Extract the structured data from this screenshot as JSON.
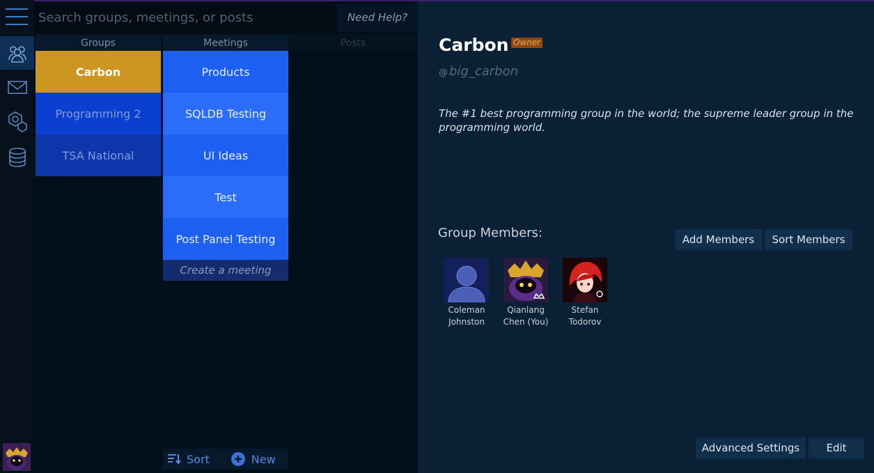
{
  "search": {
    "placeholder": "Search groups, meetings, or posts",
    "help_label": "Need Help?"
  },
  "columns": {
    "groups": "Groups",
    "meetings": "Meetings",
    "posts": "Posts"
  },
  "groups": [
    {
      "label": "Carbon",
      "selected": true
    },
    {
      "label": "Programming 2",
      "selected": false
    },
    {
      "label": "TSA National",
      "selected": false
    }
  ],
  "meetings": [
    {
      "label": "Products"
    },
    {
      "label": "SQLDB Testing"
    },
    {
      "label": "UI Ideas"
    },
    {
      "label": "Test"
    },
    {
      "label": "Post Panel Testing"
    }
  ],
  "create_meeting_label": "Create a meeting",
  "bottom_bar": {
    "sort_label": "Sort",
    "new_label": "New"
  },
  "group_detail": {
    "name": "Carbon",
    "role_badge": "Owner",
    "handle": "big_carbon",
    "handle_prefix": "@",
    "description": "The #1 best programming group in the world; the supreme leader group in the programming world.",
    "members_title": "Group Members:",
    "add_members_label": "Add Members",
    "sort_members_label": "Sort Members",
    "members": [
      {
        "first": "Coleman",
        "last": "Johnston"
      },
      {
        "first": "Qianlang",
        "last": "Chen (You)"
      },
      {
        "first": "Stefan",
        "last": "Todorov"
      }
    ],
    "advanced_settings_label": "Advanced Settings",
    "edit_label": "Edit"
  },
  "colors": {
    "selected_group": "#cc9620",
    "group_bg": "#0a3fd0",
    "group_bg_alt": "#0c36a9",
    "meeting_bg": "#1d5ff0",
    "meeting_bg_alt": "#2b6cf9",
    "accent": "#3e7cc4"
  },
  "icons": {
    "rail": [
      "menu-icon",
      "groups-icon",
      "mail-icon",
      "settings-icon",
      "database-icon"
    ],
    "bottom": [
      "sort-icon",
      "plus-circle-icon"
    ]
  }
}
